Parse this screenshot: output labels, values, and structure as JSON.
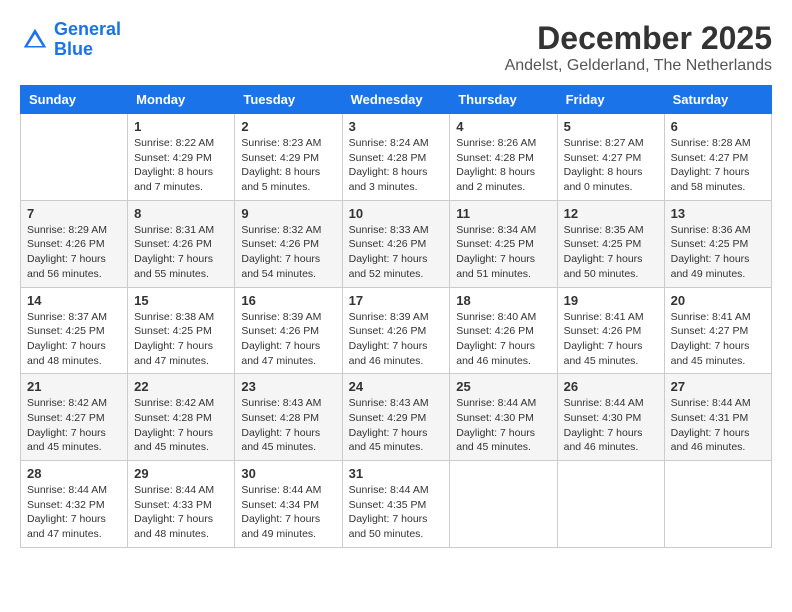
{
  "header": {
    "logo_line1": "General",
    "logo_line2": "Blue",
    "month": "December 2025",
    "location": "Andelst, Gelderland, The Netherlands"
  },
  "days_of_week": [
    "Sunday",
    "Monday",
    "Tuesday",
    "Wednesday",
    "Thursday",
    "Friday",
    "Saturday"
  ],
  "weeks": [
    [
      {
        "day": "",
        "info": ""
      },
      {
        "day": "1",
        "info": "Sunrise: 8:22 AM\nSunset: 4:29 PM\nDaylight: 8 hours\nand 7 minutes."
      },
      {
        "day": "2",
        "info": "Sunrise: 8:23 AM\nSunset: 4:29 PM\nDaylight: 8 hours\nand 5 minutes."
      },
      {
        "day": "3",
        "info": "Sunrise: 8:24 AM\nSunset: 4:28 PM\nDaylight: 8 hours\nand 3 minutes."
      },
      {
        "day": "4",
        "info": "Sunrise: 8:26 AM\nSunset: 4:28 PM\nDaylight: 8 hours\nand 2 minutes."
      },
      {
        "day": "5",
        "info": "Sunrise: 8:27 AM\nSunset: 4:27 PM\nDaylight: 8 hours\nand 0 minutes."
      },
      {
        "day": "6",
        "info": "Sunrise: 8:28 AM\nSunset: 4:27 PM\nDaylight: 7 hours\nand 58 minutes."
      }
    ],
    [
      {
        "day": "7",
        "info": "Sunrise: 8:29 AM\nSunset: 4:26 PM\nDaylight: 7 hours\nand 56 minutes."
      },
      {
        "day": "8",
        "info": "Sunrise: 8:31 AM\nSunset: 4:26 PM\nDaylight: 7 hours\nand 55 minutes."
      },
      {
        "day": "9",
        "info": "Sunrise: 8:32 AM\nSunset: 4:26 PM\nDaylight: 7 hours\nand 54 minutes."
      },
      {
        "day": "10",
        "info": "Sunrise: 8:33 AM\nSunset: 4:26 PM\nDaylight: 7 hours\nand 52 minutes."
      },
      {
        "day": "11",
        "info": "Sunrise: 8:34 AM\nSunset: 4:25 PM\nDaylight: 7 hours\nand 51 minutes."
      },
      {
        "day": "12",
        "info": "Sunrise: 8:35 AM\nSunset: 4:25 PM\nDaylight: 7 hours\nand 50 minutes."
      },
      {
        "day": "13",
        "info": "Sunrise: 8:36 AM\nSunset: 4:25 PM\nDaylight: 7 hours\nand 49 minutes."
      }
    ],
    [
      {
        "day": "14",
        "info": "Sunrise: 8:37 AM\nSunset: 4:25 PM\nDaylight: 7 hours\nand 48 minutes."
      },
      {
        "day": "15",
        "info": "Sunrise: 8:38 AM\nSunset: 4:25 PM\nDaylight: 7 hours\nand 47 minutes."
      },
      {
        "day": "16",
        "info": "Sunrise: 8:39 AM\nSunset: 4:26 PM\nDaylight: 7 hours\nand 47 minutes."
      },
      {
        "day": "17",
        "info": "Sunrise: 8:39 AM\nSunset: 4:26 PM\nDaylight: 7 hours\nand 46 minutes."
      },
      {
        "day": "18",
        "info": "Sunrise: 8:40 AM\nSunset: 4:26 PM\nDaylight: 7 hours\nand 46 minutes."
      },
      {
        "day": "19",
        "info": "Sunrise: 8:41 AM\nSunset: 4:26 PM\nDaylight: 7 hours\nand 45 minutes."
      },
      {
        "day": "20",
        "info": "Sunrise: 8:41 AM\nSunset: 4:27 PM\nDaylight: 7 hours\nand 45 minutes."
      }
    ],
    [
      {
        "day": "21",
        "info": "Sunrise: 8:42 AM\nSunset: 4:27 PM\nDaylight: 7 hours\nand 45 minutes."
      },
      {
        "day": "22",
        "info": "Sunrise: 8:42 AM\nSunset: 4:28 PM\nDaylight: 7 hours\nand 45 minutes."
      },
      {
        "day": "23",
        "info": "Sunrise: 8:43 AM\nSunset: 4:28 PM\nDaylight: 7 hours\nand 45 minutes."
      },
      {
        "day": "24",
        "info": "Sunrise: 8:43 AM\nSunset: 4:29 PM\nDaylight: 7 hours\nand 45 minutes."
      },
      {
        "day": "25",
        "info": "Sunrise: 8:44 AM\nSunset: 4:30 PM\nDaylight: 7 hours\nand 45 minutes."
      },
      {
        "day": "26",
        "info": "Sunrise: 8:44 AM\nSunset: 4:30 PM\nDaylight: 7 hours\nand 46 minutes."
      },
      {
        "day": "27",
        "info": "Sunrise: 8:44 AM\nSunset: 4:31 PM\nDaylight: 7 hours\nand 46 minutes."
      }
    ],
    [
      {
        "day": "28",
        "info": "Sunrise: 8:44 AM\nSunset: 4:32 PM\nDaylight: 7 hours\nand 47 minutes."
      },
      {
        "day": "29",
        "info": "Sunrise: 8:44 AM\nSunset: 4:33 PM\nDaylight: 7 hours\nand 48 minutes."
      },
      {
        "day": "30",
        "info": "Sunrise: 8:44 AM\nSunset: 4:34 PM\nDaylight: 7 hours\nand 49 minutes."
      },
      {
        "day": "31",
        "info": "Sunrise: 8:44 AM\nSunset: 4:35 PM\nDaylight: 7 hours\nand 50 minutes."
      },
      {
        "day": "",
        "info": ""
      },
      {
        "day": "",
        "info": ""
      },
      {
        "day": "",
        "info": ""
      }
    ]
  ]
}
